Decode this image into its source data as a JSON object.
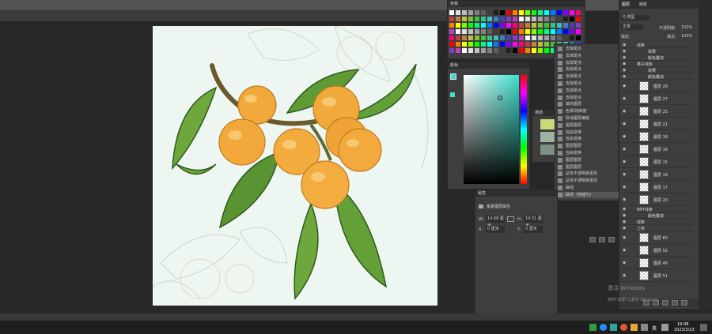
{
  "swatches_panel": {
    "title": "色板"
  },
  "color_panel": {
    "title": "颜色"
  },
  "channels_panel": {
    "title": "通道"
  },
  "history": {
    "items": [
      "去除斑点",
      "去除斑点",
      "去除斑点",
      "去除斑点",
      "去除斑点",
      "去除斑点",
      "去除斑点",
      "去除斑点",
      "填充图层",
      "色相/饱和度",
      "取消图层编组",
      "图层图层",
      "自由变换",
      "自由变换",
      "图层图层",
      "自由变换",
      "图层图层",
      "图层图层",
      "总体不透明度更改",
      "总体不透明度更改",
      "曲线",
      "曲线（存储为）"
    ]
  },
  "properties_panel": {
    "title": "属性",
    "subtitle": "像素图层属性",
    "w_label": "W:",
    "w_value": "14.68 厘米",
    "h_label": "H:",
    "h_value": "14.51 厘米",
    "x_label": "X:",
    "x_value": "0 厘米",
    "y_label": "Y:",
    "y_value": "0 厘米",
    "link_icon": "link-icon"
  },
  "layers_panel": {
    "tab1": "图层",
    "tab2": "通道",
    "filter_type": "Q 类型",
    "blend_mode": "正常",
    "opacity_label": "不透明度:",
    "opacity_value": "100%",
    "lock_label": "锁定:",
    "fill_label": "填充:",
    "fill_value": "100%",
    "rows": [
      {
        "name": "线条",
        "kind": "group"
      },
      {
        "name": "效果",
        "kind": "fx"
      },
      {
        "name": "颜色叠加",
        "kind": "fx"
      },
      {
        "name": "果子线条",
        "kind": "group"
      },
      {
        "name": "效果",
        "kind": "fx"
      },
      {
        "name": "颜色叠加",
        "kind": "fx"
      },
      {
        "name": "图层 28",
        "kind": "layer"
      },
      {
        "name": "图层 27",
        "kind": "layer"
      },
      {
        "name": "图层 25",
        "kind": "layer"
      },
      {
        "name": "图层 21",
        "kind": "layer"
      },
      {
        "name": "图层 18",
        "kind": "layer"
      },
      {
        "name": "图层 16",
        "kind": "layer"
      },
      {
        "name": "图层 15",
        "kind": "layer"
      },
      {
        "name": "图层 19",
        "kind": "layer"
      },
      {
        "name": "图层 17",
        "kind": "layer"
      },
      {
        "name": "图层 20",
        "kind": "layer"
      },
      {
        "name": "树叶线条",
        "kind": "group"
      },
      {
        "name": "颜色叠加",
        "kind": "fx"
      },
      {
        "name": "线条",
        "kind": "group"
      },
      {
        "name": "上色",
        "kind": "group"
      },
      {
        "name": "图层 60",
        "kind": "layer"
      },
      {
        "name": "图层 52",
        "kind": "layer"
      },
      {
        "name": "图层 46",
        "kind": "layer"
      },
      {
        "name": "图层 51",
        "kind": "layer"
      }
    ]
  },
  "watermark": {
    "line1": "激活 Windows",
    "line2": "转到\"设置\"以激活 Windows。"
  },
  "taskbar": {
    "ime": "英",
    "time": "19:08",
    "date": "2023/3/23"
  },
  "colors": {
    "canvas_bg": "#eef6f1",
    "orange": "#f2a93b",
    "leaf": "#5f9a35",
    "picker_hue": "#3de0d0"
  }
}
